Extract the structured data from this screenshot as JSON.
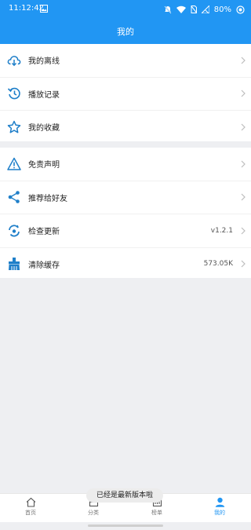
{
  "status_bar": {
    "time": "11:12:42",
    "battery": "80%"
  },
  "header": {
    "title": "我的"
  },
  "menu_group_1": [
    {
      "label": "我的离线",
      "icon": "cloud-download-icon"
    },
    {
      "label": "播放记录",
      "icon": "history-icon"
    },
    {
      "label": "我的收藏",
      "icon": "star-icon"
    }
  ],
  "menu_group_2": [
    {
      "label": "免责声明",
      "icon": "warning-icon",
      "value": ""
    },
    {
      "label": "推荐给好友",
      "icon": "share-icon",
      "value": ""
    },
    {
      "label": "检查更新",
      "icon": "update-icon",
      "value": "v1.2.1"
    },
    {
      "label": "清除缓存",
      "icon": "clear-cache-icon",
      "value": "573.05K"
    }
  ],
  "toast": "已经是最新版本啦",
  "bottom_nav": [
    {
      "label": "首页",
      "icon": "home-icon",
      "active": false
    },
    {
      "label": "分类",
      "icon": "category-icon",
      "active": false
    },
    {
      "label": "榜单",
      "icon": "ranking-icon",
      "active": false
    },
    {
      "label": "我的",
      "icon": "profile-icon",
      "active": true
    }
  ],
  "colors": {
    "primary": "#2196f3",
    "icon_blue": "#1f7fc9",
    "background": "#eeeff2"
  }
}
